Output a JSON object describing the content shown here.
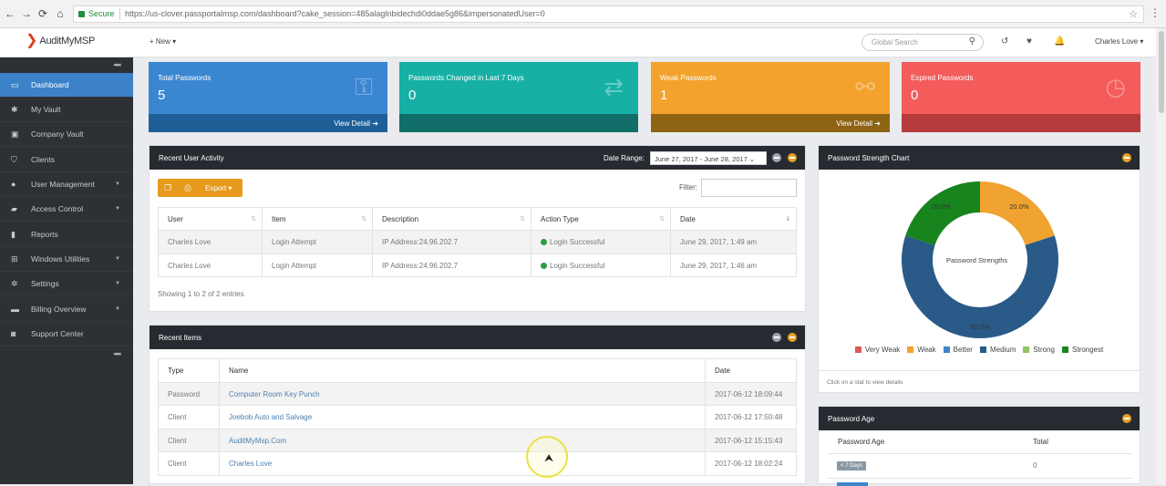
{
  "browser": {
    "secure_label": "Secure",
    "url": "https://us-clover.passportalmsp.com/dashboard?cake_session=485alaglnbidechdi0ddae5g86&impersonatedUser=0"
  },
  "topbar": {
    "logo_text": "AuditMyMSP",
    "new_label": "+ New ▾",
    "search_placeholder": "Global Search",
    "user_name": "Charles Love ▾"
  },
  "sidebar": {
    "collapse_glyph": "◂◂◂",
    "items": [
      {
        "label": "Dashboard",
        "icon": "laptop-icon",
        "glyph": "▭"
      },
      {
        "label": "My Vault",
        "icon": "asterisk-icon",
        "glyph": "✱"
      },
      {
        "label": "Company Vault",
        "icon": "building-icon",
        "glyph": "▣"
      },
      {
        "label": "Clients",
        "icon": "shield-icon",
        "glyph": "⛉"
      },
      {
        "label": "User Management",
        "icon": "user-icon",
        "glyph": "●"
      },
      {
        "label": "Access Control",
        "icon": "lock-icon",
        "glyph": "▰"
      },
      {
        "label": "Reports",
        "icon": "bar-chart-icon",
        "glyph": "▮"
      },
      {
        "label": "Windows Utilities",
        "icon": "windows-icon",
        "glyph": "⊞"
      },
      {
        "label": "Settings",
        "icon": "gears-icon",
        "glyph": "✲"
      },
      {
        "label": "Billing Overview",
        "icon": "credit-card-icon",
        "glyph": "▬"
      },
      {
        "label": "Support Center",
        "icon": "support-icon",
        "glyph": "◙"
      }
    ]
  },
  "cards": [
    {
      "title": "Total Passwords",
      "value": "5",
      "footer": "View Detail ➜",
      "icon": "key-icon",
      "glyph": "⚿",
      "color": "#3b86d1",
      "footer_color": "#1f5f98"
    },
    {
      "title": "Passwords Changed in Last 7 Days",
      "value": "0",
      "footer": "",
      "icon": "exchange-icon",
      "glyph": "⇄",
      "color": "#16b0a6",
      "footer_color": "#126e68"
    },
    {
      "title": "Weak Passwords",
      "value": "1",
      "footer": "View Detail ➜",
      "icon": "chain-broken-icon",
      "glyph": "⚯",
      "color": "#f2a22d",
      "footer_color": "#8e6414"
    },
    {
      "title": "Expired Passwords",
      "value": "0",
      "footer": "",
      "icon": "clock-icon",
      "glyph": "◷",
      "color": "#f45b5b",
      "footer_color": "#b63b3d"
    }
  ],
  "activity": {
    "title": "Recent User Activity",
    "date_range_label": "Date Range:",
    "date_range_value": "June 27, 2017 - June 28, 2017",
    "export_label": "Export ▾",
    "filter_label": "Filter:",
    "columns": [
      "User",
      "Item",
      "Description",
      "Action Type",
      "Date"
    ],
    "rows": [
      {
        "user": "Charles Love",
        "item": "Login Attempt",
        "description": "IP Address:24.96.202.7",
        "action": "Login Successful",
        "date": "June 29, 2017, 1:49 am"
      },
      {
        "user": "Charles Love",
        "item": "Login Attempt",
        "description": "IP Address:24.96.202.7",
        "action": "Login Successful",
        "date": "June 29, 2017, 1:46 am"
      }
    ],
    "footer": "Showing 1 to 2 of 2 entries"
  },
  "recent_items": {
    "title": "Recent Items",
    "columns": [
      "Type",
      "Name",
      "Date"
    ],
    "rows": [
      {
        "type": "Password",
        "name": "Computer Room Key Punch",
        "date": "2017-06-12 18:09:44"
      },
      {
        "type": "Client",
        "name": "Joebob Auto and Salvage",
        "date": "2017-06-12 17:50:48"
      },
      {
        "type": "Client",
        "name": "AuditMyMsp.Com",
        "date": "2017-06-12 15:15:43"
      },
      {
        "type": "Client",
        "name": "Charles Love",
        "date": "2017-06-12 18:02:24"
      }
    ]
  },
  "strength_chart": {
    "title": "Password Strength Chart",
    "center_label": "Password Strengths",
    "hint": "Click on a stat to view details"
  },
  "chart_data": {
    "type": "pie",
    "categories": [
      "Very Weak",
      "Weak",
      "Better",
      "Medium",
      "Strong",
      "Strongest"
    ],
    "values": [
      0,
      20,
      0,
      60,
      0,
      20
    ],
    "slice_labels": [
      "",
      "20.0%",
      "",
      "60.0%",
      "",
      "20.0%"
    ],
    "colors": [
      "#e0575a",
      "#f0a330",
      "#3f86c9",
      "#2a5a88",
      "#8cc562",
      "#17841e"
    ],
    "legend": "bottom"
  },
  "password_age": {
    "title": "Password Age",
    "columns": [
      "Password Age",
      "Total"
    ],
    "rows": [
      {
        "age": "< 7 Days",
        "total": "0"
      }
    ]
  }
}
